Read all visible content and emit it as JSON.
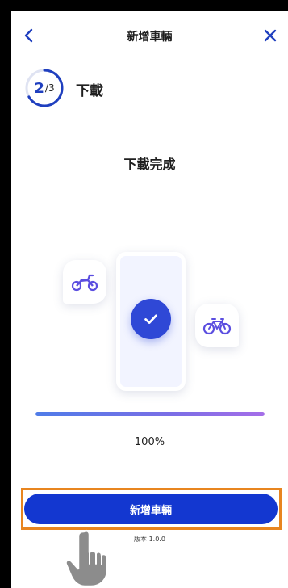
{
  "header": {
    "title": "新增車輛",
    "back_icon": "chevron-left-icon",
    "close_icon": "close-icon"
  },
  "step": {
    "current": "2",
    "total": "/3",
    "label": "下載",
    "progress_fraction": 0.6667
  },
  "status": {
    "message": "下載完成"
  },
  "illustration": {
    "icons": [
      "motorcycle-icon",
      "check-icon",
      "bicycle-icon"
    ]
  },
  "progress": {
    "percent": 100,
    "text": "100%"
  },
  "actions": {
    "add_button_label": "新增車輛"
  },
  "footer": {
    "version": "版本 1.0.0"
  },
  "colors": {
    "brand_blue": "#1337d0",
    "highlight_orange": "#e8851f",
    "icon_purple": "#5b4ee0"
  }
}
